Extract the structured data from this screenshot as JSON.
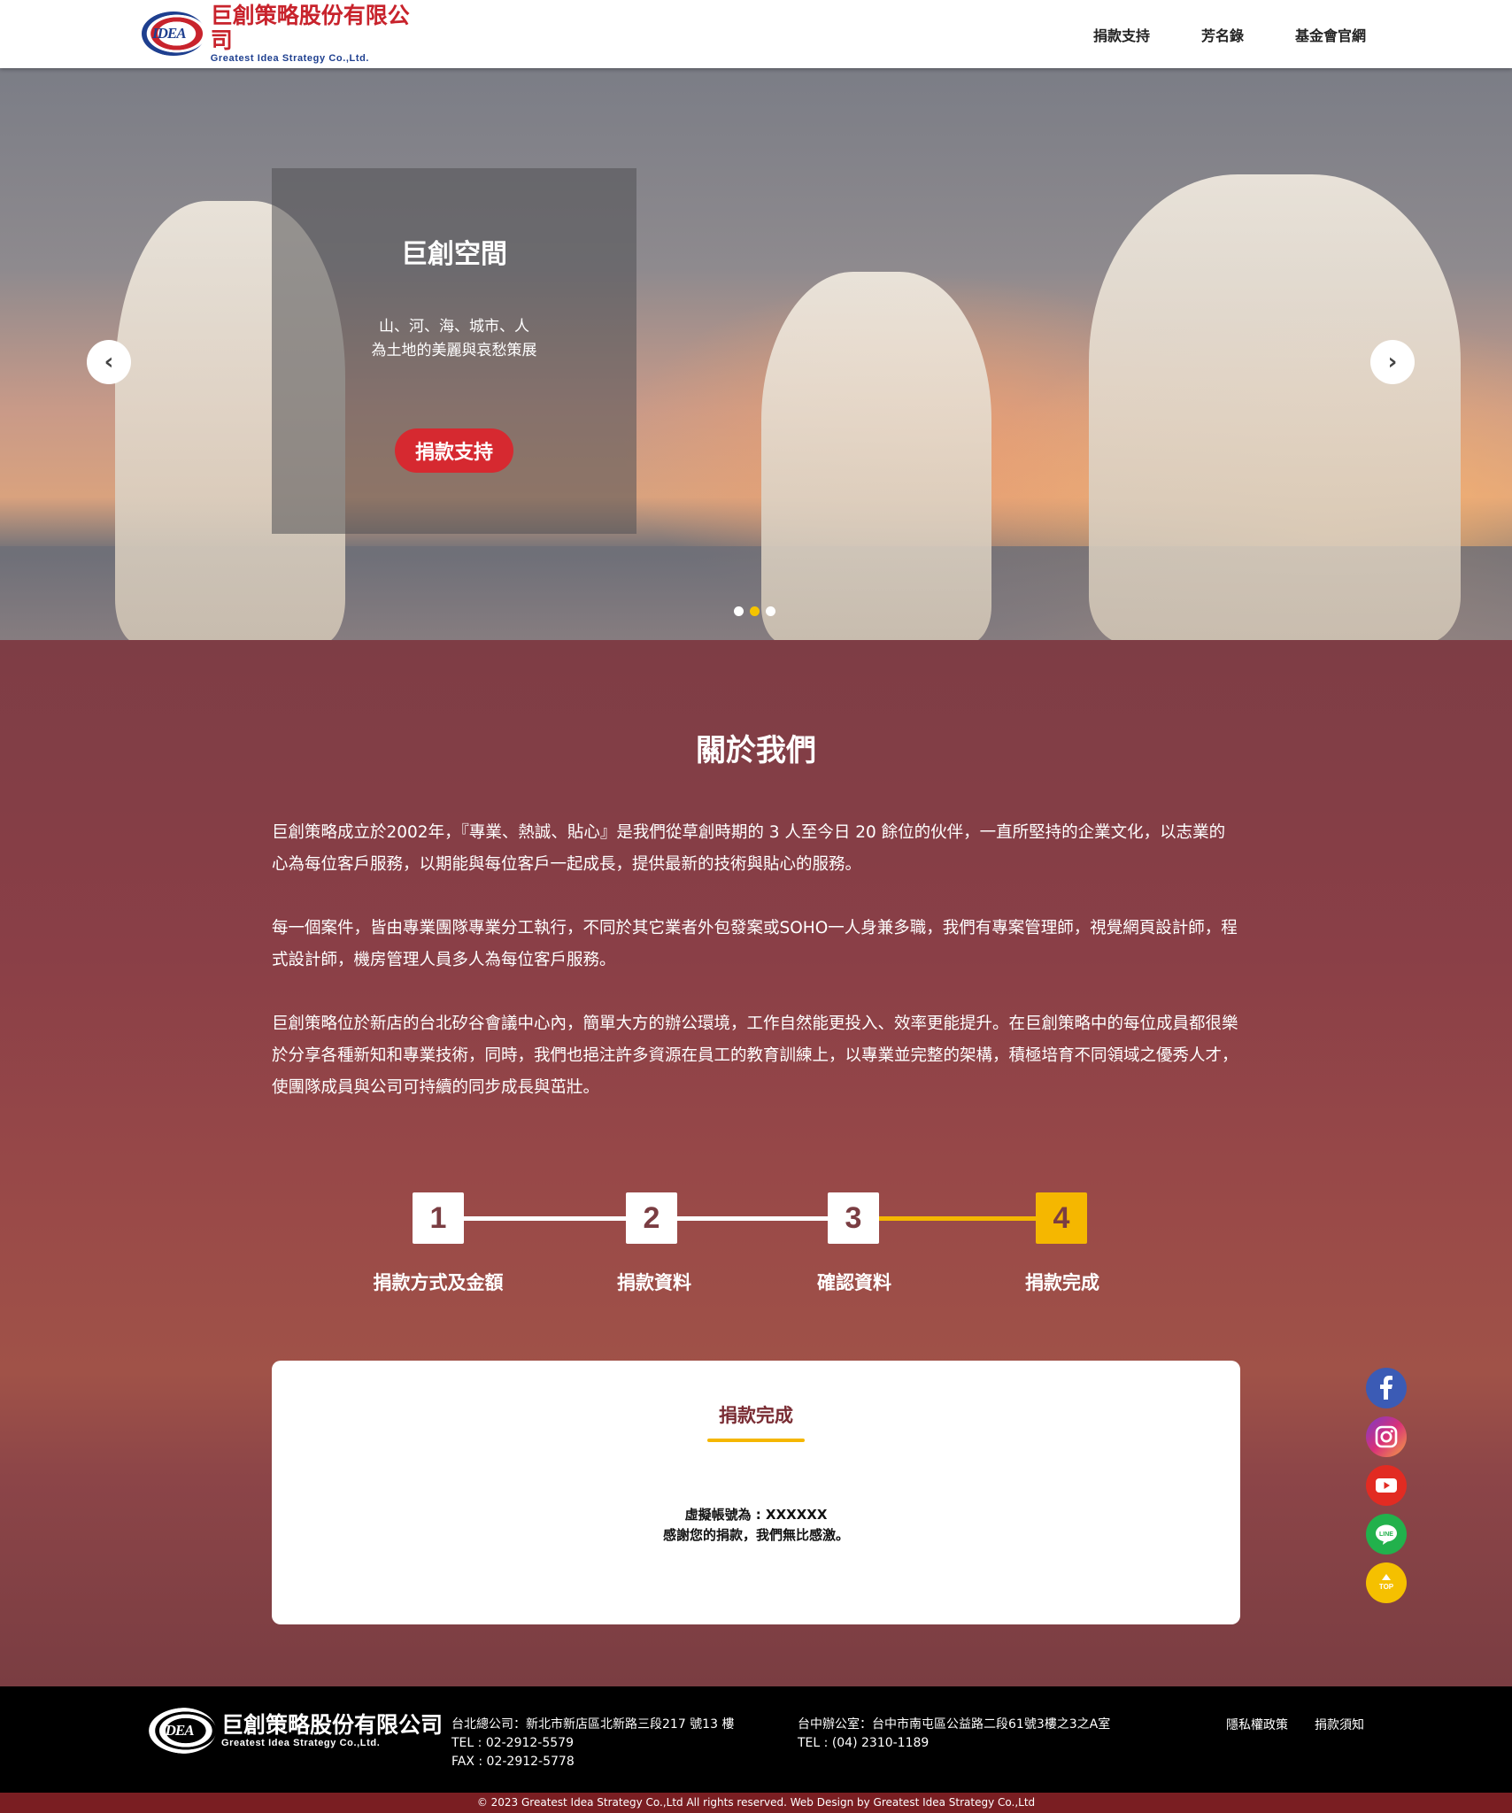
{
  "header": {
    "logo_mark": "IDEA",
    "logo_zh": "巨創策略股份有限公司",
    "logo_en": "Greatest Idea Strategy Co.,Ltd.",
    "nav": [
      "捐款支持",
      "芳名錄",
      "基金會官網"
    ]
  },
  "hero": {
    "title": "巨創空間",
    "subtitle_line1": "山、河、海、城市、人",
    "subtitle_line2": "為土地的美麗與哀愁策展",
    "cta": "捐款支持",
    "prev_icon": "‹",
    "next_icon": "›",
    "slide_count": 3,
    "active_slide": 2
  },
  "about": {
    "title": "關於我們",
    "paragraphs": [
      "巨創策略成立於2002年，『專業、熱誠、貼心』是我們從草創時期的 3 人至今日 20 餘位的伙伴，一直所堅持的企業文化，以志業的心為每位客戶服務，以期能與每位客戶一起成長，提供最新的技術與貼心的服務。",
      "每一個案件，皆由專業團隊專業分工執行，不同於其它業者外包發案或SOHO一人身兼多職，我們有專案管理師，視覺網頁設計師，程式設計師，機房管理人員多人為每位客戶服務。",
      "巨創策略位於新店的台北矽谷會議中心內，簡單大方的辦公環境，工作自然能更投入、效率更能提升。在巨創策略中的每位成員都很樂於分享各種新知和專業技術，同時，我們也挹注許多資源在員工的教育訓練上，以專業並完整的架構，積極培育不同領域之優秀人才，使團隊成員與公司可持續的同步成長與茁壯。"
    ]
  },
  "steps": {
    "items": [
      {
        "num": "1",
        "label": "捐款方式及金額"
      },
      {
        "num": "2",
        "label": "捐款資料"
      },
      {
        "num": "3",
        "label": "確認資料"
      },
      {
        "num": "4",
        "label": "捐款完成"
      }
    ],
    "current": 4
  },
  "result": {
    "title": "捐款完成",
    "line1": "虛擬帳號為 : XXXXXX",
    "line2": "感謝您的捐款，我們無比感激。"
  },
  "social": {
    "items": [
      "facebook-icon",
      "instagram-icon",
      "youtube-icon",
      "line-icon",
      "back-to-top-icon"
    ],
    "line_text": "LINE",
    "top_text": "TOP"
  },
  "footer": {
    "logo_mark": "IDEA",
    "logo_zh": "巨創策略股份有限公司",
    "logo_en": "Greatest Idea Strategy Co.,Ltd.",
    "taipei": {
      "address": "台北總公司：新北市新店區北新路三段217 號13 樓",
      "tel": "TEL : 02-2912-5579",
      "fax": "FAX : 02-2912-5778"
    },
    "taichung": {
      "address": "台中辦公室：台中市南屯區公益路二段61號3樓之3之A室",
      "tel": "TEL : (04) 2310-1189"
    },
    "links": [
      "隱私權政策",
      "捐款須知"
    ],
    "copyright": "© 2023 Greatest Idea Strategy Co.,Ltd All rights reserved. Web Design by Greatest Idea Strategy Co.,Ltd"
  },
  "colors": {
    "brand_red": "#c8232c",
    "brand_blue": "#1e3f8f",
    "accent_yellow": "#f5b700",
    "cta_red": "#d62930",
    "copyright_bar": "#7a1e22"
  }
}
